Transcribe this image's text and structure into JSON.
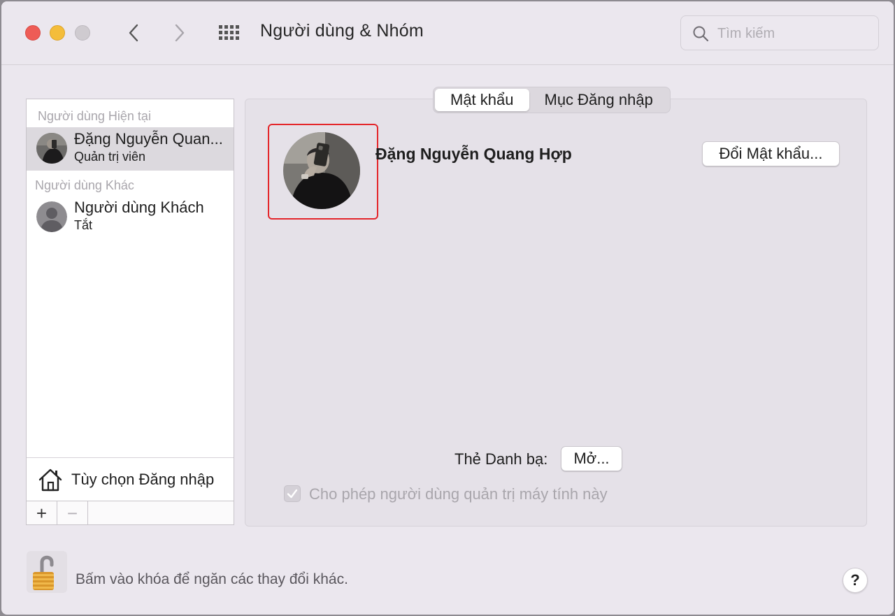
{
  "window": {
    "title": "Người dùng & Nhóm"
  },
  "search": {
    "placeholder": "Tìm kiếm"
  },
  "sidebar": {
    "current_section": "Người dùng Hiện tại",
    "current_user": {
      "name": "Đặng Nguyễn Quan...",
      "role": "Quản trị viên"
    },
    "other_section": "Người dùng Khác",
    "guest_user": {
      "name": "Người dùng Khách",
      "role": "Tắt"
    },
    "login_options_label": "Tùy chọn Đăng nhập",
    "add_label": "+",
    "remove_label": "−"
  },
  "tabs": [
    {
      "label": "Mật khẩu",
      "active": true
    },
    {
      "label": "Mục Đăng nhập",
      "active": false
    }
  ],
  "main": {
    "full_name": "Đặng Nguyễn Quang Hợp",
    "change_password_label": "Đổi Mật khẩu...",
    "contact_card_label": "Thẻ Danh bạ:",
    "open_label": "Mở...",
    "admin_checkbox_label": "Cho phép người dùng quản trị máy tính này",
    "admin_checked": true
  },
  "footer": {
    "lock_label": "Bấm vào khóa để ngăn các thay đổi khác.",
    "help_label": "?"
  },
  "icons": {
    "back": "chevron-left-icon",
    "forward": "chevron-right-icon",
    "grid": "grid-icon",
    "search": "search-icon",
    "home": "house-icon",
    "lock": "unlocked-padlock-icon"
  },
  "colors": {
    "close": "#ee5c56",
    "minimize": "#f4bd3a",
    "highlight": "#e4262b"
  }
}
